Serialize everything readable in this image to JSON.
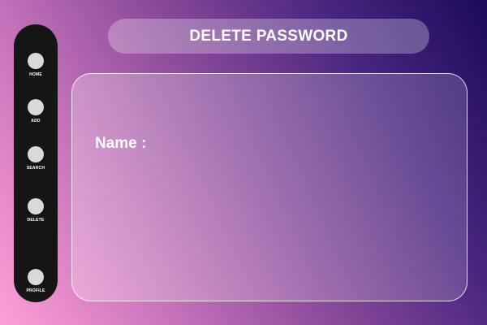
{
  "page": {
    "title": "DELETE PASSWORD"
  },
  "sidebar": {
    "items": [
      {
        "label": "HOME",
        "icon": "circle-icon"
      },
      {
        "label": "ADD",
        "icon": "circle-icon"
      },
      {
        "label": "SEARCH",
        "icon": "circle-icon"
      },
      {
        "label": "DELETE",
        "icon": "circle-icon"
      },
      {
        "label": "PROFILE",
        "icon": "circle-icon"
      }
    ]
  },
  "form": {
    "name_label": "Name :"
  },
  "colors": {
    "sidebar_bg": "#161515",
    "nav_dot": "#d9d9d9",
    "text": "#ffffff",
    "gradient_start": "#ff9ed6",
    "gradient_end": "#1c0a5c"
  }
}
